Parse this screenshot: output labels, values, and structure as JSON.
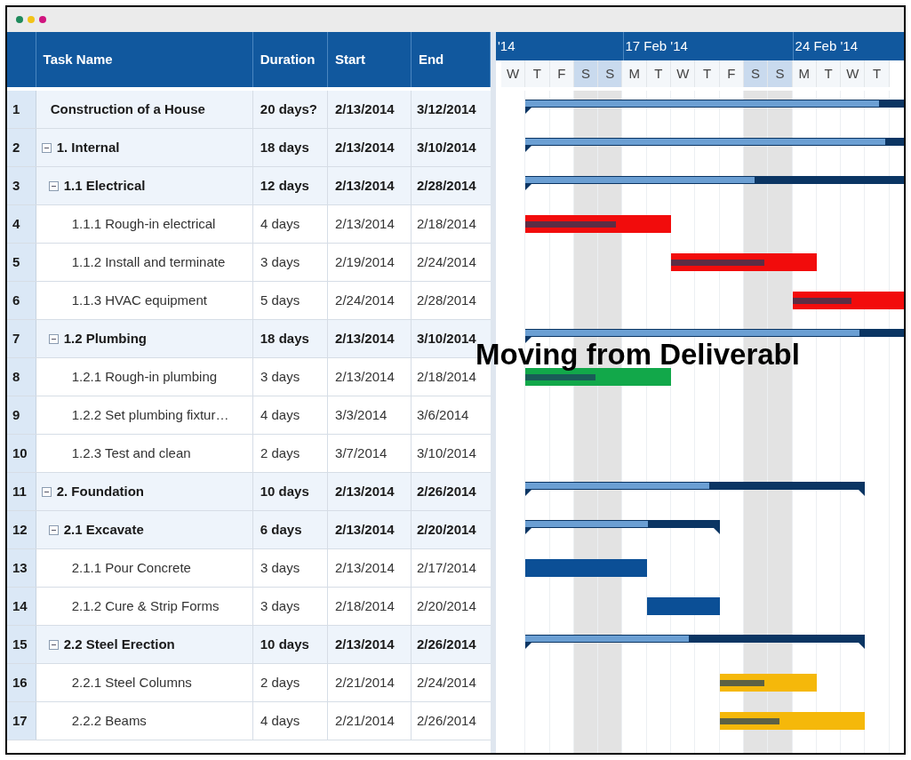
{
  "window": {
    "controls": [
      {
        "color": "#1f8a5c"
      },
      {
        "color": "#f2c318"
      },
      {
        "color": "#d0157f"
      }
    ]
  },
  "table": {
    "columns": [
      "Task Name",
      "Duration",
      "Start",
      "End"
    ],
    "rows": [
      {
        "number": "1",
        "name": "Construction of a House",
        "duration": "20 days?",
        "start": "2/13/2014",
        "end": "3/12/2014",
        "kind": "summary",
        "bar": {
          "kind": "summary",
          "level": 0.52
        },
        "children": [
          {
            "number": "2",
            "name": "1. Internal",
            "duration": "18 days",
            "start": "2/13/2014",
            "end": "3/10/2014",
            "kind": "summary",
            "expanded": true,
            "bar": {
              "kind": "summary",
              "level": 0.57
            },
            "children": [
              {
                "number": "3",
                "name": "1.1 Electrical",
                "duration": "12 days",
                "start": "2/13/2014",
                "end": "2/28/2014",
                "kind": "summary",
                "expanded": true,
                "bar": {
                  "kind": "summary",
                  "level": 0.59
                },
                "children": [
                  {
                    "number": "4",
                    "name": "1.1.1 Rough-in electrical",
                    "duration": "4 days",
                    "start": "2/13/2014",
                    "end": "2/18/2014",
                    "kind": "task",
                    "bar": {
                      "kind": "task",
                      "color": "#f20c0c",
                      "level": 0.62
                    }
                  },
                  {
                    "number": "5",
                    "name": "1.1.2 Install and terminate",
                    "duration": "3 days",
                    "start": "2/19/2014",
                    "end": "2/24/2014",
                    "kind": "task",
                    "bar": {
                      "kind": "task",
                      "color": "#f20c0c",
                      "level": 0.64
                    }
                  },
                  {
                    "number": "6",
                    "name": "1.1.3  HVAC equipment",
                    "duration": "5 days",
                    "start": "2/24/2014",
                    "end": "2/28/2014",
                    "kind": "task",
                    "bar": {
                      "kind": "task",
                      "color": "#f20c0c",
                      "level": 0.49
                    }
                  }
                ]
              },
              {
                "number": "7",
                "name": "1.2 Plumbing",
                "duration": "18 days",
                "start": "2/13/2014",
                "end": "3/10/2014",
                "kind": "summary",
                "expanded": true,
                "bar": {
                  "kind": "summary",
                  "level": 0.53
                },
                "children": [
                  {
                    "number": "8",
                    "name": "1.2.1 Rough-in plumbing",
                    "duration": "3 days",
                    "start": "2/13/2014",
                    "end": "2/18/2014",
                    "kind": "task",
                    "bar": {
                      "kind": "task",
                      "color": "#12a84a",
                      "level": 0.48
                    }
                  },
                  {
                    "number": "9",
                    "name": "1.2.2 Set plumbing fixtur…",
                    "duration": "4 days",
                    "start": "3/3/2014",
                    "end": "3/6/2014",
                    "kind": "task"
                  },
                  {
                    "number": "10",
                    "name": "1.2.3 Test and clean",
                    "duration": "2 days",
                    "start": "3/7/2014",
                    "end": "3/10/2014",
                    "kind": "task"
                  }
                ]
              }
            ]
          },
          {
            "number": "11",
            "name": "2. Foundation",
            "duration": "10 days",
            "start": "2/13/2014",
            "end": "2/26/2014",
            "kind": "summary",
            "expanded": true,
            "bar": {
              "kind": "summary",
              "level": 0.54
            },
            "children": [
              {
                "number": "12",
                "name": "2.1 Excavate",
                "duration": "6 days",
                "start": "2/13/2014",
                "end": "2/20/2014",
                "kind": "summary",
                "expanded": true,
                "bar": {
                  "kind": "summary",
                  "level": 0.63
                },
                "children": [
                  {
                    "number": "13",
                    "name": "2.1.1 Pour Concrete",
                    "duration": "3 days",
                    "start": "2/13/2014",
                    "end": "2/17/2014",
                    "kind": "task",
                    "bar": {
                      "kind": "task",
                      "color": "#0b4f96",
                      "level": 0
                    }
                  },
                  {
                    "number": "14",
                    "name": "2.1.2 Cure & Strip Forms",
                    "duration": "3 days",
                    "start": "2/18/2014",
                    "end": "2/20/2014",
                    "kind": "task",
                    "bar": {
                      "kind": "task",
                      "color": "#0b4f96",
                      "level": 0
                    }
                  }
                ]
              },
              {
                "number": "15",
                "name": "2.2 Steel Erection",
                "duration": "10 days",
                "start": "2/13/2014",
                "end": "2/26/2014",
                "kind": "summary",
                "expanded": true,
                "bar": {
                  "kind": "summary",
                  "level": 0.48
                },
                "children": [
                  {
                    "number": "16",
                    "name": "2.2.1 Steel Columns",
                    "duration": "2 days",
                    "start": "2/21/2014",
                    "end": "2/24/2014",
                    "kind": "task",
                    "bar": {
                      "kind": "task",
                      "color": "#f5b80a",
                      "level": 0.46
                    }
                  },
                  {
                    "number": "17",
                    "name": "2.2.2 Beams",
                    "duration": "4 days",
                    "start": "2/21/2014",
                    "end": "2/26/2014",
                    "kind": "task",
                    "bar": {
                      "kind": "task",
                      "color": "#f5b80a",
                      "level": 0.41
                    }
                  }
                ]
              }
            ]
          }
        ]
      }
    ]
  },
  "timeline": {
    "weeks": [
      {
        "label": "'14"
      },
      {
        "label": "17 Feb '14"
      },
      {
        "label": "24 Feb '14"
      }
    ],
    "days": [
      {
        "label": "W",
        "weekend": false
      },
      {
        "label": "T",
        "weekend": false
      },
      {
        "label": "F",
        "weekend": false
      },
      {
        "label": "S",
        "weekend": true
      },
      {
        "label": "S",
        "weekend": true
      },
      {
        "label": "M",
        "weekend": false
      },
      {
        "label": "T",
        "weekend": false
      },
      {
        "label": "W",
        "weekend": false
      },
      {
        "label": "T",
        "weekend": false
      },
      {
        "label": "F",
        "weekend": false
      },
      {
        "label": "S",
        "weekend": true
      },
      {
        "label": "S",
        "weekend": true
      },
      {
        "label": "M",
        "weekend": false
      },
      {
        "label": "T",
        "weekend": false
      },
      {
        "label": "W",
        "weekend": false
      },
      {
        "label": "T",
        "weekend": false
      }
    ]
  },
  "overlay_title": "Moving from Deliverabl"
}
